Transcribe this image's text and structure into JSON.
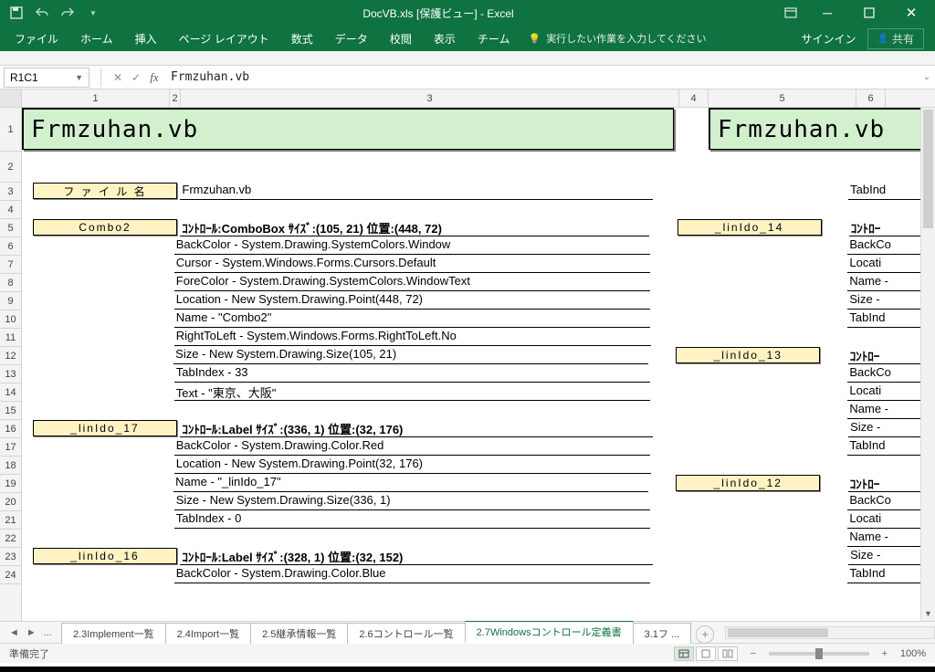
{
  "title": "DocVB.xls  [保護ビュー] - Excel",
  "qat": {
    "save": "save",
    "undo": "undo",
    "redo": "redo"
  },
  "winbtns": {
    "ribbon_opts": "⋯",
    "min": "—",
    "max": "☐",
    "close": "✕"
  },
  "ribbon": {
    "tabs": [
      "ファイル",
      "ホーム",
      "挿入",
      "ページ レイアウト",
      "数式",
      "データ",
      "校閲",
      "表示",
      "チーム"
    ],
    "tellme_placeholder": "実行したい作業を入力してください",
    "signin": "サインイン",
    "share": "共有"
  },
  "formula_bar": {
    "name_box": "R1C1",
    "value": "Frmzuhan.vb"
  },
  "columns": [
    "1",
    "2",
    "3",
    "4",
    "5",
    "6"
  ],
  "row_numbers": [
    "1",
    "2",
    "3",
    "4",
    "5",
    "6",
    "7",
    "8",
    "9",
    "10",
    "11",
    "12",
    "13",
    "14",
    "15",
    "16",
    "17",
    "18",
    "19",
    "20",
    "21",
    "22",
    "23",
    "24"
  ],
  "header_left": "Frmzuhan.vb",
  "header_right": "Frmzuhan.vb",
  "left_tags": {
    "r3": "フ ァ イ ル 名",
    "r5": "Combo2",
    "r16": "_linIdo_17",
    "r23": "_linIdo_16"
  },
  "right_tags": {
    "r5": "_linIdo_14",
    "r12": "_linIdo_13",
    "r19": "_linIdo_12"
  },
  "col3": {
    "r3": "Frmzuhan.vb",
    "r5": "ｺﾝﾄﾛｰﾙ:ComboBox  ｻｲｽﾞ:(105, 21)  位置:(448, 72)",
    "r6": "BackColor - System.Drawing.SystemColors.Window",
    "r7": "Cursor - System.Windows.Forms.Cursors.Default",
    "r8": "ForeColor - System.Drawing.SystemColors.WindowText",
    "r9": "Location - New System.Drawing.Point(448, 72)",
    "r10": "Name - \"Combo2\"",
    "r11": "RightToLeft - System.Windows.Forms.RightToLeft.No",
    "r12": "Size - New System.Drawing.Size(105, 21)",
    "r13": "TabIndex - 33",
    "r14": "Text - \"東京、大阪\"",
    "r16": "ｺﾝﾄﾛｰﾙ:Label  ｻｲｽﾞ:(336, 1)  位置:(32, 176)",
    "r17": "BackColor - System.Drawing.Color.Red",
    "r18": "Location - New System.Drawing.Point(32, 176)",
    "r19": "Name - \"_linIdo_17\"",
    "r20": "Size - New System.Drawing.Size(336, 1)",
    "r21": "TabIndex - 0",
    "r23": "ｺﾝﾄﾛｰﾙ:Label  ｻｲｽﾞ:(328, 1)  位置:(32, 152)",
    "r24": "BackColor - System.Drawing.Color.Blue"
  },
  "col7": {
    "r3": "TabInd",
    "r5": "ｺﾝﾄﾛｰ",
    "r6": "BackCo",
    "r7": "Locati",
    "r8": "Name -",
    "r9": "Size -",
    "r10": "TabInd",
    "r12": "ｺﾝﾄﾛｰ",
    "r13": "BackCo",
    "r14": "Locati",
    "r15": "Name -",
    "r16": "Size -",
    "r17": "TabInd",
    "r19": "ｺﾝﾄﾛｰ",
    "r20": "BackCo",
    "r21": "Locati",
    "r22": "Name -",
    "r23": "Size -",
    "r24": "TabInd"
  },
  "sheet_tabs": {
    "more": "...",
    "tabs": [
      "2.3Implement一覧",
      "2.4Import一覧",
      "2.5継承情報一覧",
      "2.6コントロール一覧"
    ],
    "active": "2.7Windowsコントロール定義書",
    "after": "3.1フ ..."
  },
  "status": {
    "ready": "準備完了",
    "zoom": "100%"
  }
}
